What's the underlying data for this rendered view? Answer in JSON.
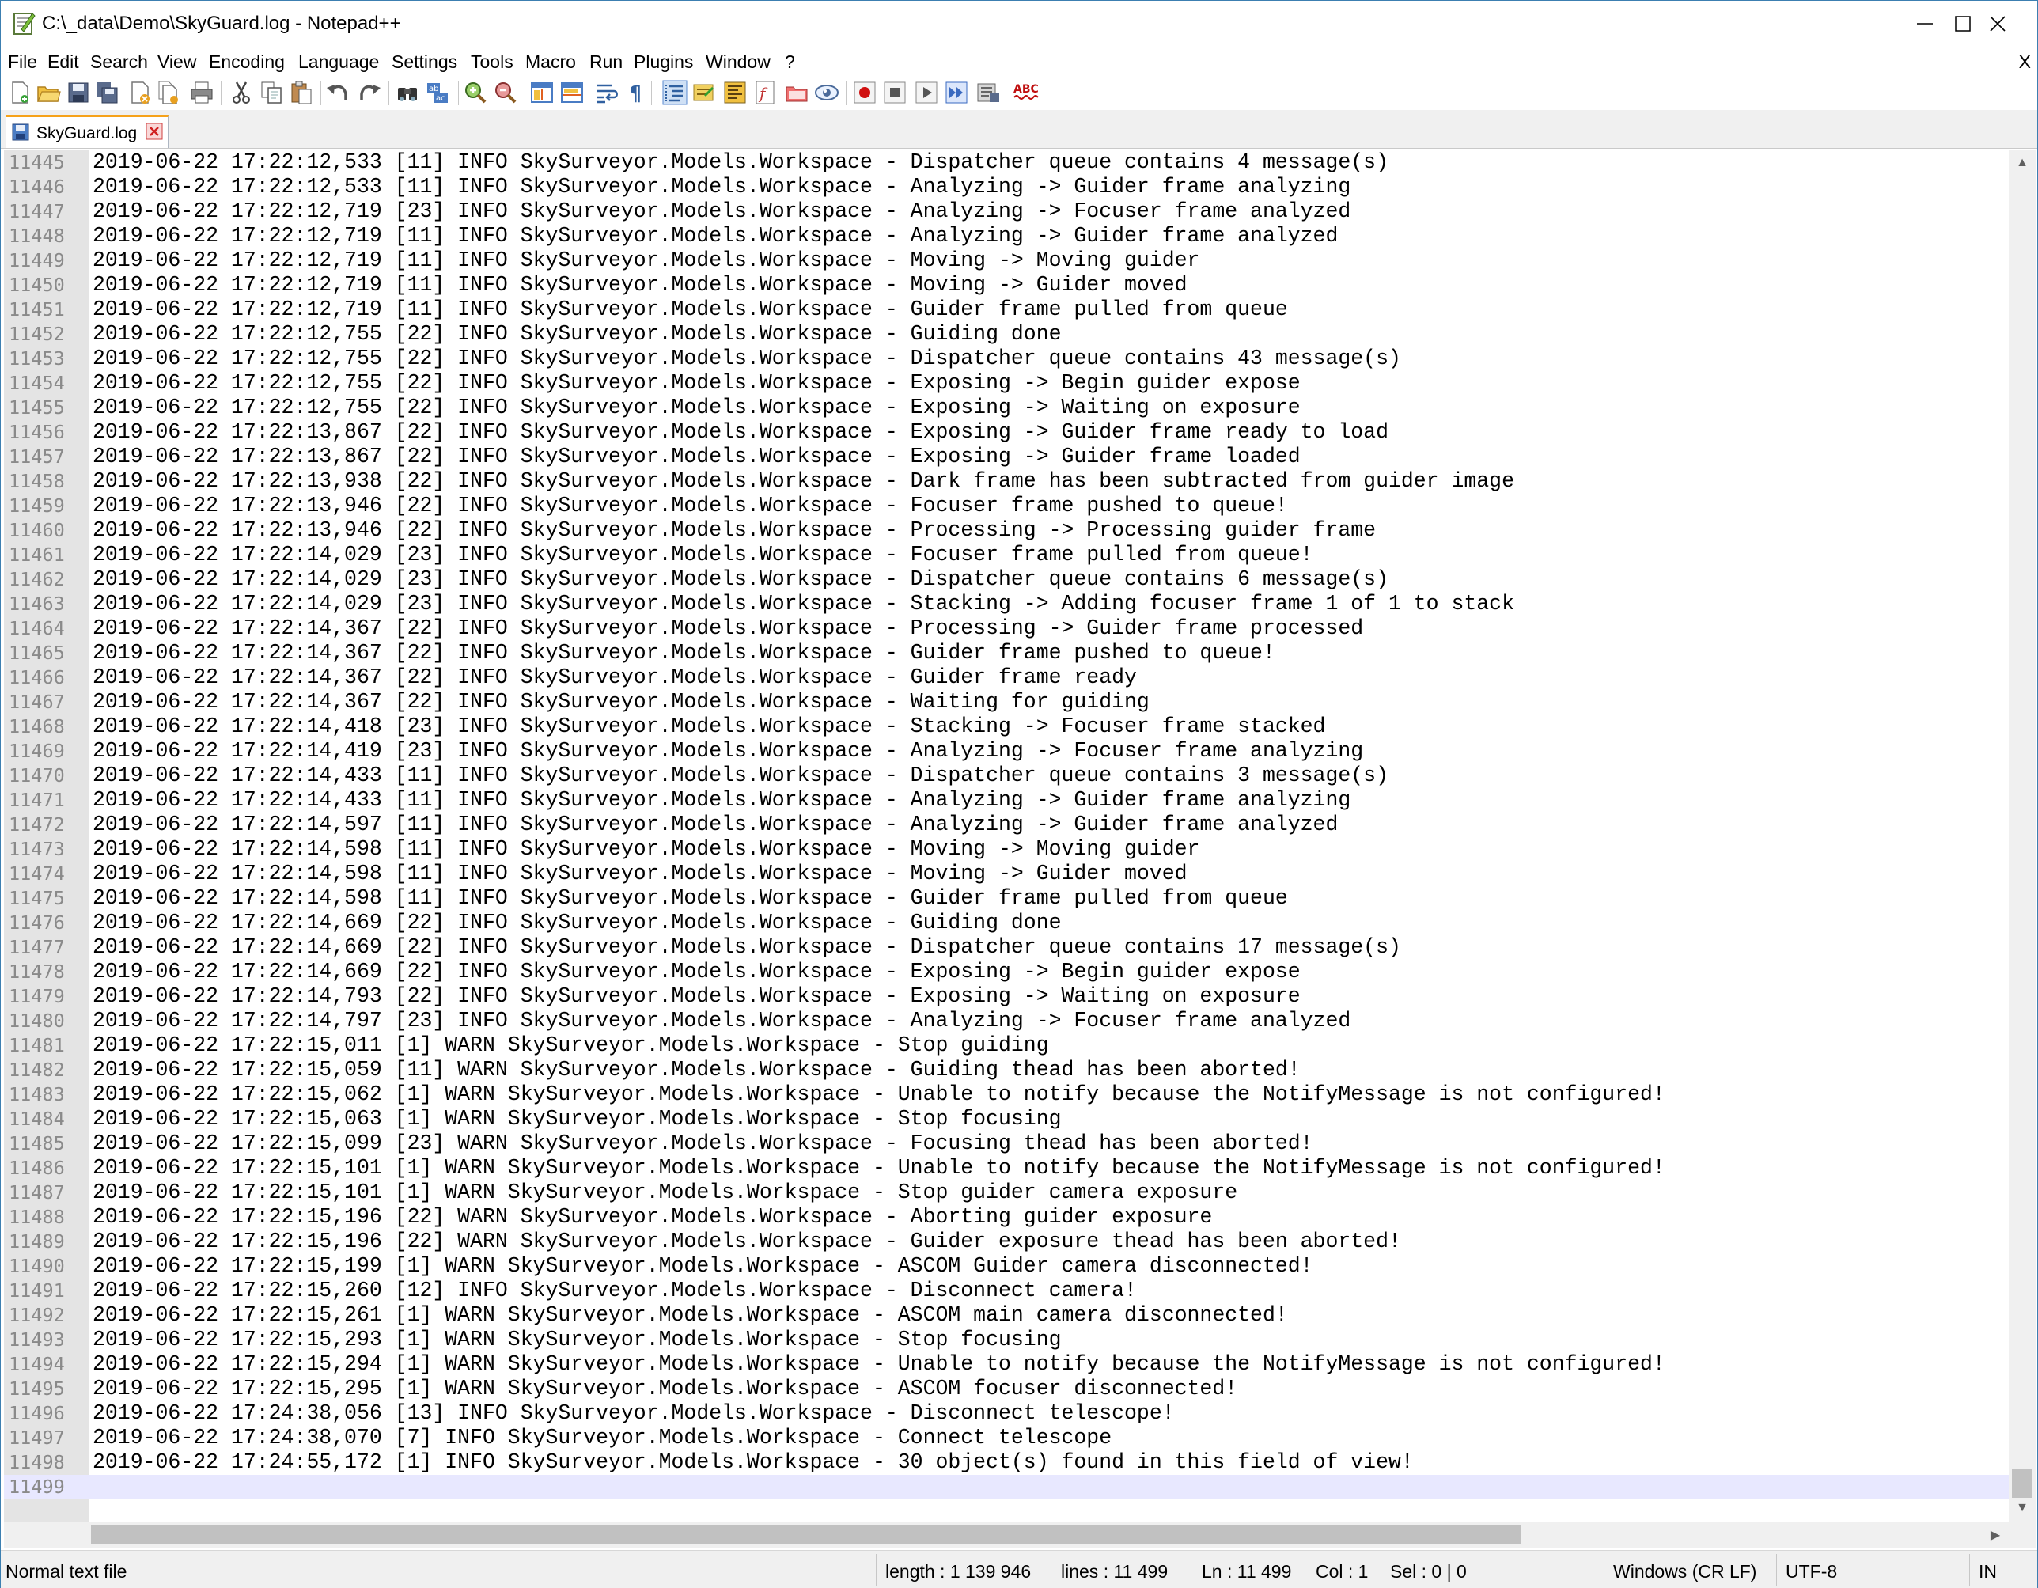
{
  "window": {
    "title": "C:\\_data\\Demo\\SkyGuard.log - Notepad++",
    "minimize_glyph": "─",
    "maximize_glyph": "☐",
    "close_glyph": "✕"
  },
  "menu": {
    "items": [
      "File",
      "Edit",
      "Search",
      "View",
      "Encoding",
      "Language",
      "Settings",
      "Tools",
      "Macro",
      "Run",
      "Plugins",
      "Window",
      "?"
    ],
    "close_doc": "X"
  },
  "toolbar": {
    "icons": [
      "new-file-icon",
      "open-file-icon",
      "save-icon",
      "save-all-icon",
      "close-icon",
      "close-all-icon",
      "print-icon",
      "cut-icon",
      "copy-icon",
      "paste-icon",
      "undo-icon",
      "redo-icon",
      "find-icon",
      "replace-icon",
      "zoom-in-icon",
      "zoom-out-icon",
      "sync-vertical-icon",
      "sync-horizontal-icon",
      "word-wrap-icon",
      "show-all-chars-icon",
      "indent-guide-icon",
      "document-map-icon",
      "function-list-icon",
      "pdf-icon",
      "folder-icon",
      "monitor-icon",
      "record-macro-icon",
      "stop-record-icon",
      "play-macro-icon",
      "run-macro-multiple-icon",
      "save-macro-icon",
      "spell-check-icon"
    ],
    "spell_check_label": "ABC"
  },
  "tab": {
    "label": "SkyGuard.log"
  },
  "editor": {
    "lines": [
      {
        "n": "11445",
        "t": "2019-06-22 17:22:12,533 [11] INFO SkySurveyor.Models.Workspace - Dispatcher queue contains 4 message(s)"
      },
      {
        "n": "11446",
        "t": "2019-06-22 17:22:12,533 [11] INFO SkySurveyor.Models.Workspace - Analyzing -> Guider frame analyzing"
      },
      {
        "n": "11447",
        "t": "2019-06-22 17:22:12,719 [23] INFO SkySurveyor.Models.Workspace - Analyzing -> Focuser frame analyzed"
      },
      {
        "n": "11448",
        "t": "2019-06-22 17:22:12,719 [11] INFO SkySurveyor.Models.Workspace - Analyzing -> Guider frame analyzed"
      },
      {
        "n": "11449",
        "t": "2019-06-22 17:22:12,719 [11] INFO SkySurveyor.Models.Workspace - Moving -> Moving guider"
      },
      {
        "n": "11450",
        "t": "2019-06-22 17:22:12,719 [11] INFO SkySurveyor.Models.Workspace - Moving -> Guider moved"
      },
      {
        "n": "11451",
        "t": "2019-06-22 17:22:12,719 [11] INFO SkySurveyor.Models.Workspace - Guider frame pulled from queue"
      },
      {
        "n": "11452",
        "t": "2019-06-22 17:22:12,755 [22] INFO SkySurveyor.Models.Workspace - Guiding done"
      },
      {
        "n": "11453",
        "t": "2019-06-22 17:22:12,755 [22] INFO SkySurveyor.Models.Workspace - Dispatcher queue contains 43 message(s)"
      },
      {
        "n": "11454",
        "t": "2019-06-22 17:22:12,755 [22] INFO SkySurveyor.Models.Workspace - Exposing -> Begin guider expose"
      },
      {
        "n": "11455",
        "t": "2019-06-22 17:22:12,755 [22] INFO SkySurveyor.Models.Workspace - Exposing -> Waiting on exposure"
      },
      {
        "n": "11456",
        "t": "2019-06-22 17:22:13,867 [22] INFO SkySurveyor.Models.Workspace - Exposing -> Guider frame ready to load"
      },
      {
        "n": "11457",
        "t": "2019-06-22 17:22:13,867 [22] INFO SkySurveyor.Models.Workspace - Exposing -> Guider frame loaded"
      },
      {
        "n": "11458",
        "t": "2019-06-22 17:22:13,938 [22] INFO SkySurveyor.Models.Workspace - Dark frame has been subtracted from guider image"
      },
      {
        "n": "11459",
        "t": "2019-06-22 17:22:13,946 [22] INFO SkySurveyor.Models.Workspace - Focuser frame pushed to queue!"
      },
      {
        "n": "11460",
        "t": "2019-06-22 17:22:13,946 [22] INFO SkySurveyor.Models.Workspace - Processing -> Processing guider frame"
      },
      {
        "n": "11461",
        "t": "2019-06-22 17:22:14,029 [23] INFO SkySurveyor.Models.Workspace - Focuser frame pulled from queue!"
      },
      {
        "n": "11462",
        "t": "2019-06-22 17:22:14,029 [23] INFO SkySurveyor.Models.Workspace - Dispatcher queue contains 6 message(s)"
      },
      {
        "n": "11463",
        "t": "2019-06-22 17:22:14,029 [23] INFO SkySurveyor.Models.Workspace - Stacking -> Adding focuser frame 1 of 1 to stack"
      },
      {
        "n": "11464",
        "t": "2019-06-22 17:22:14,367 [22] INFO SkySurveyor.Models.Workspace - Processing -> Guider frame processed"
      },
      {
        "n": "11465",
        "t": "2019-06-22 17:22:14,367 [22] INFO SkySurveyor.Models.Workspace - Guider frame pushed to queue!"
      },
      {
        "n": "11466",
        "t": "2019-06-22 17:22:14,367 [22] INFO SkySurveyor.Models.Workspace - Guider frame ready"
      },
      {
        "n": "11467",
        "t": "2019-06-22 17:22:14,367 [22] INFO SkySurveyor.Models.Workspace - Waiting for guiding"
      },
      {
        "n": "11468",
        "t": "2019-06-22 17:22:14,418 [23] INFO SkySurveyor.Models.Workspace - Stacking -> Focuser frame stacked"
      },
      {
        "n": "11469",
        "t": "2019-06-22 17:22:14,419 [23] INFO SkySurveyor.Models.Workspace - Analyzing -> Focuser frame analyzing"
      },
      {
        "n": "11470",
        "t": "2019-06-22 17:22:14,433 [11] INFO SkySurveyor.Models.Workspace - Dispatcher queue contains 3 message(s)"
      },
      {
        "n": "11471",
        "t": "2019-06-22 17:22:14,433 [11] INFO SkySurveyor.Models.Workspace - Analyzing -> Guider frame analyzing"
      },
      {
        "n": "11472",
        "t": "2019-06-22 17:22:14,597 [11] INFO SkySurveyor.Models.Workspace - Analyzing -> Guider frame analyzed"
      },
      {
        "n": "11473",
        "t": "2019-06-22 17:22:14,598 [11] INFO SkySurveyor.Models.Workspace - Moving -> Moving guider"
      },
      {
        "n": "11474",
        "t": "2019-06-22 17:22:14,598 [11] INFO SkySurveyor.Models.Workspace - Moving -> Guider moved"
      },
      {
        "n": "11475",
        "t": "2019-06-22 17:22:14,598 [11] INFO SkySurveyor.Models.Workspace - Guider frame pulled from queue"
      },
      {
        "n": "11476",
        "t": "2019-06-22 17:22:14,669 [22] INFO SkySurveyor.Models.Workspace - Guiding done"
      },
      {
        "n": "11477",
        "t": "2019-06-22 17:22:14,669 [22] INFO SkySurveyor.Models.Workspace - Dispatcher queue contains 17 message(s)"
      },
      {
        "n": "11478",
        "t": "2019-06-22 17:22:14,669 [22] INFO SkySurveyor.Models.Workspace - Exposing -> Begin guider expose"
      },
      {
        "n": "11479",
        "t": "2019-06-22 17:22:14,793 [22] INFO SkySurveyor.Models.Workspace - Exposing -> Waiting on exposure"
      },
      {
        "n": "11480",
        "t": "2019-06-22 17:22:14,797 [23] INFO SkySurveyor.Models.Workspace - Analyzing -> Focuser frame analyzed"
      },
      {
        "n": "11481",
        "t": "2019-06-22 17:22:15,011 [1] WARN SkySurveyor.Models.Workspace - Stop guiding"
      },
      {
        "n": "11482",
        "t": "2019-06-22 17:22:15,059 [11] WARN SkySurveyor.Models.Workspace - Guiding thead has been aborted!"
      },
      {
        "n": "11483",
        "t": "2019-06-22 17:22:15,062 [1] WARN SkySurveyor.Models.Workspace - Unable to notify because the NotifyMessage is not configured!"
      },
      {
        "n": "11484",
        "t": "2019-06-22 17:22:15,063 [1] WARN SkySurveyor.Models.Workspace - Stop focusing"
      },
      {
        "n": "11485",
        "t": "2019-06-22 17:22:15,099 [23] WARN SkySurveyor.Models.Workspace - Focusing thead has been aborted!"
      },
      {
        "n": "11486",
        "t": "2019-06-22 17:22:15,101 [1] WARN SkySurveyor.Models.Workspace - Unable to notify because the NotifyMessage is not configured!"
      },
      {
        "n": "11487",
        "t": "2019-06-22 17:22:15,101 [1] WARN SkySurveyor.Models.Workspace - Stop guider camera exposure"
      },
      {
        "n": "11488",
        "t": "2019-06-22 17:22:15,196 [22] WARN SkySurveyor.Models.Workspace - Aborting guider exposure"
      },
      {
        "n": "11489",
        "t": "2019-06-22 17:22:15,196 [22] WARN SkySurveyor.Models.Workspace - Guider exposure thead has been aborted!"
      },
      {
        "n": "11490",
        "t": "2019-06-22 17:22:15,199 [1] WARN SkySurveyor.Models.Workspace - ASCOM Guider camera disconnected!"
      },
      {
        "n": "11491",
        "t": "2019-06-22 17:22:15,260 [12] INFO SkySurveyor.Models.Workspace - Disconnect camera!"
      },
      {
        "n": "11492",
        "t": "2019-06-22 17:22:15,261 [1] WARN SkySurveyor.Models.Workspace - ASCOM main camera disconnected!"
      },
      {
        "n": "11493",
        "t": "2019-06-22 17:22:15,293 [1] WARN SkySurveyor.Models.Workspace - Stop focusing"
      },
      {
        "n": "11494",
        "t": "2019-06-22 17:22:15,294 [1] WARN SkySurveyor.Models.Workspace - Unable to notify because the NotifyMessage is not configured!"
      },
      {
        "n": "11495",
        "t": "2019-06-22 17:22:15,295 [1] WARN SkySurveyor.Models.Workspace - ASCOM focuser disconnected!"
      },
      {
        "n": "11496",
        "t": "2019-06-22 17:24:38,056 [13] INFO SkySurveyor.Models.Workspace - Disconnect telescope!"
      },
      {
        "n": "11497",
        "t": "2019-06-22 17:24:38,070 [7] INFO SkySurveyor.Models.Workspace - Connect telescope"
      },
      {
        "n": "11498",
        "t": "2019-06-22 17:24:55,172 [1] INFO SkySurveyor.Models.Workspace - 30 object(s) found in this field of view!"
      },
      {
        "n": "11499",
        "t": ""
      }
    ],
    "current_line": "11499"
  },
  "scrollbar": {
    "up_glyph": "▲",
    "down_glyph": "▼",
    "right_glyph": "▶"
  },
  "status": {
    "file_type": "Normal text file",
    "length": "length : 1 139 946",
    "lines": "lines : 11 499",
    "ln": "Ln : 11 499",
    "col": "Col : 1",
    "sel": "Sel : 0 | 0",
    "eol": "Windows (CR LF)",
    "encoding": "UTF-8",
    "mode": "IN"
  },
  "colors": {
    "tab_accent": "#f6a21a",
    "gutter": "#e4e4e4",
    "current_line": "#e8e8ff",
    "window_border": "#3c7fb1"
  }
}
